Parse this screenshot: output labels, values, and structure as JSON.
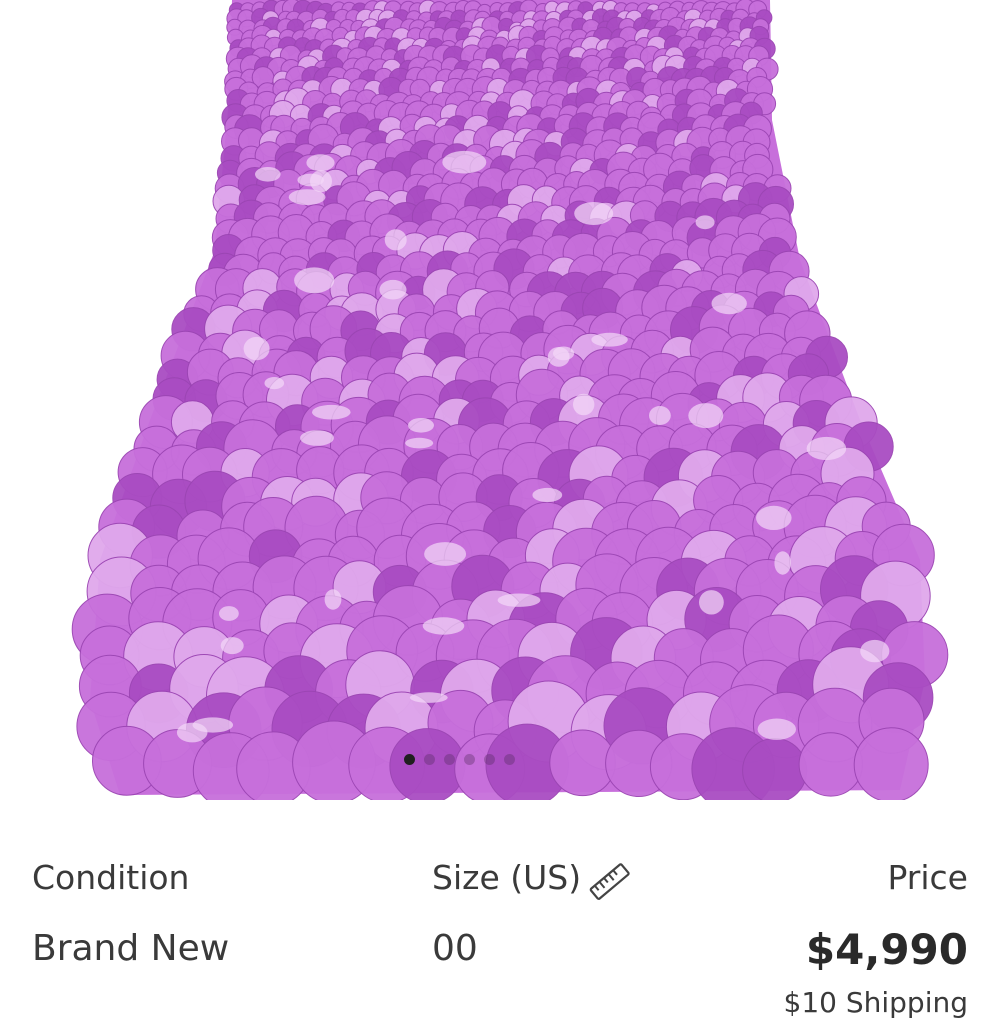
{
  "product": {
    "image_alt": "Purple paillette sequin mini skirt",
    "image_count": 6,
    "active_image_index": 0,
    "colors": {
      "sequin": "#C76FDB",
      "sequin_light": "#E0A8EC",
      "sequin_dark": "#A94CC2"
    }
  },
  "details": {
    "condition_label": "Condition",
    "condition_value": "Brand New",
    "size_label": "Size (US)",
    "size_value": "00",
    "size_icon": "ruler-icon",
    "price_label": "Price",
    "price_value": "$4,990",
    "shipping_text": "$10 Shipping"
  }
}
